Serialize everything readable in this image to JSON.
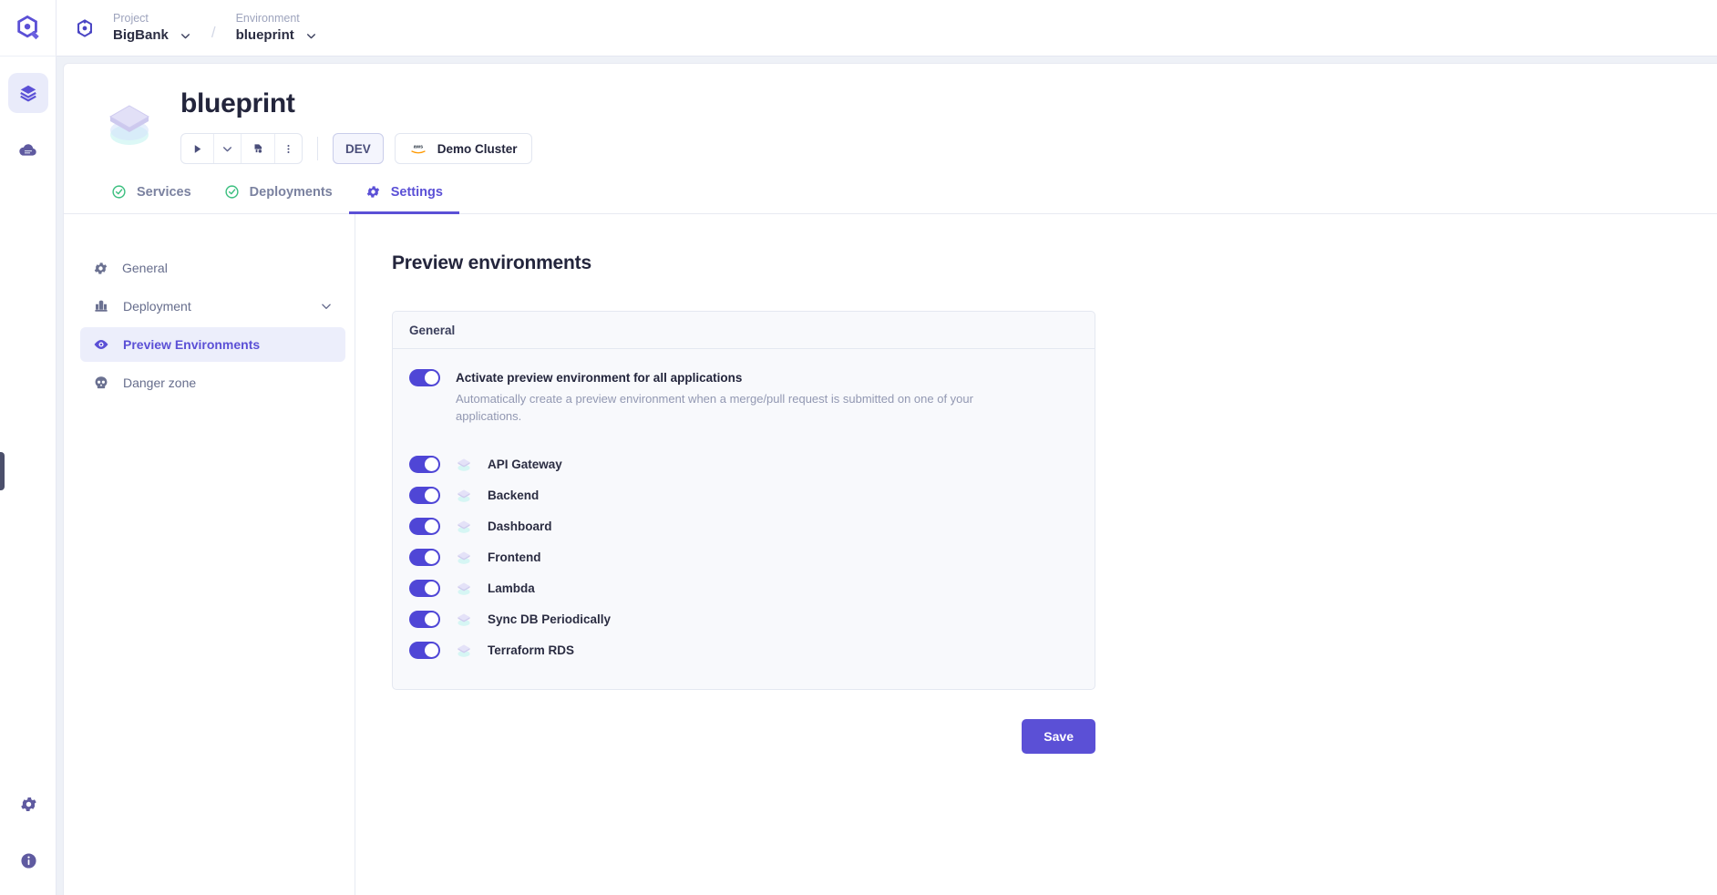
{
  "colors": {
    "accent": "#5b50d6",
    "toggle_on": "#4f46d6",
    "active_nav_bg": "#eceefb",
    "tab_ok": "#3bbf7f",
    "muted_text": "#9298b2"
  },
  "rail": {
    "logo_icon": "qovery-hexagon-logo-icon",
    "items": [
      {
        "icon": "layers-icon",
        "name": "environments",
        "active": true
      },
      {
        "icon": "cloud-icon",
        "name": "cloud-providers",
        "active": false
      }
    ],
    "bottom_items": [
      {
        "icon": "gear-icon",
        "name": "settings"
      },
      {
        "icon": "info-icon",
        "name": "help-info"
      }
    ]
  },
  "breadcrumb": {
    "logo_icon": "organization-logo-icon",
    "project": {
      "label": "Project",
      "value": "BigBank",
      "chevron": "chevron-down-icon"
    },
    "separator": "/",
    "environment": {
      "label": "Environment",
      "value": "blueprint",
      "chevron": "chevron-down-icon"
    }
  },
  "header": {
    "icon": "environment-layers-3d-icon",
    "title": "blueprint",
    "actions": [
      {
        "icon": "play-icon",
        "name": "deploy-button"
      },
      {
        "icon": "chevron-down-icon",
        "name": "deploy-options-button"
      },
      {
        "icon": "redeploy-icon",
        "name": "redeploy-button"
      },
      {
        "icon": "dots-vertical-icon",
        "name": "more-actions-button"
      }
    ],
    "env_badge": "DEV",
    "cluster": {
      "provider_icon": "aws-icon",
      "provider_label": "aws",
      "name": "Demo Cluster"
    }
  },
  "tabs": [
    {
      "label": "Services",
      "icon": "check-circle-icon",
      "active": false
    },
    {
      "label": "Deployments",
      "icon": "check-circle-icon",
      "active": false
    },
    {
      "label": "Settings",
      "icon": "gear-icon",
      "active": true
    }
  ],
  "settings_nav": [
    {
      "label": "General",
      "icon": "gear-icon",
      "active": false,
      "expandable": false
    },
    {
      "label": "Deployment",
      "icon": "rocket-icon",
      "active": false,
      "expandable": true,
      "chevron": "chevron-down-icon"
    },
    {
      "label": "Preview Environments",
      "icon": "eye-icon",
      "active": true,
      "expandable": false
    },
    {
      "label": "Danger zone",
      "icon": "skull-icon",
      "active": false,
      "expandable": false
    }
  ],
  "main": {
    "heading": "Preview environments",
    "card": {
      "section_title": "General",
      "global_toggle": {
        "on": true,
        "title": "Activate preview environment for all applications",
        "description": "Automatically create a preview environment when a merge/pull request is submitted on one of your applications."
      },
      "applications": [
        {
          "name": "API Gateway",
          "icon": "service-layers-icon",
          "on": true
        },
        {
          "name": "Backend",
          "icon": "service-layers-icon",
          "on": true
        },
        {
          "name": "Dashboard",
          "icon": "service-layers-icon",
          "on": true
        },
        {
          "name": "Frontend",
          "icon": "service-layers-icon",
          "on": true
        },
        {
          "name": "Lambda",
          "icon": "service-layers-icon",
          "on": true
        },
        {
          "name": "Sync DB Periodically",
          "icon": "service-layers-icon",
          "on": true
        },
        {
          "name": "Terraform RDS",
          "icon": "service-layers-icon",
          "on": true
        }
      ]
    },
    "save_label": "Save"
  }
}
